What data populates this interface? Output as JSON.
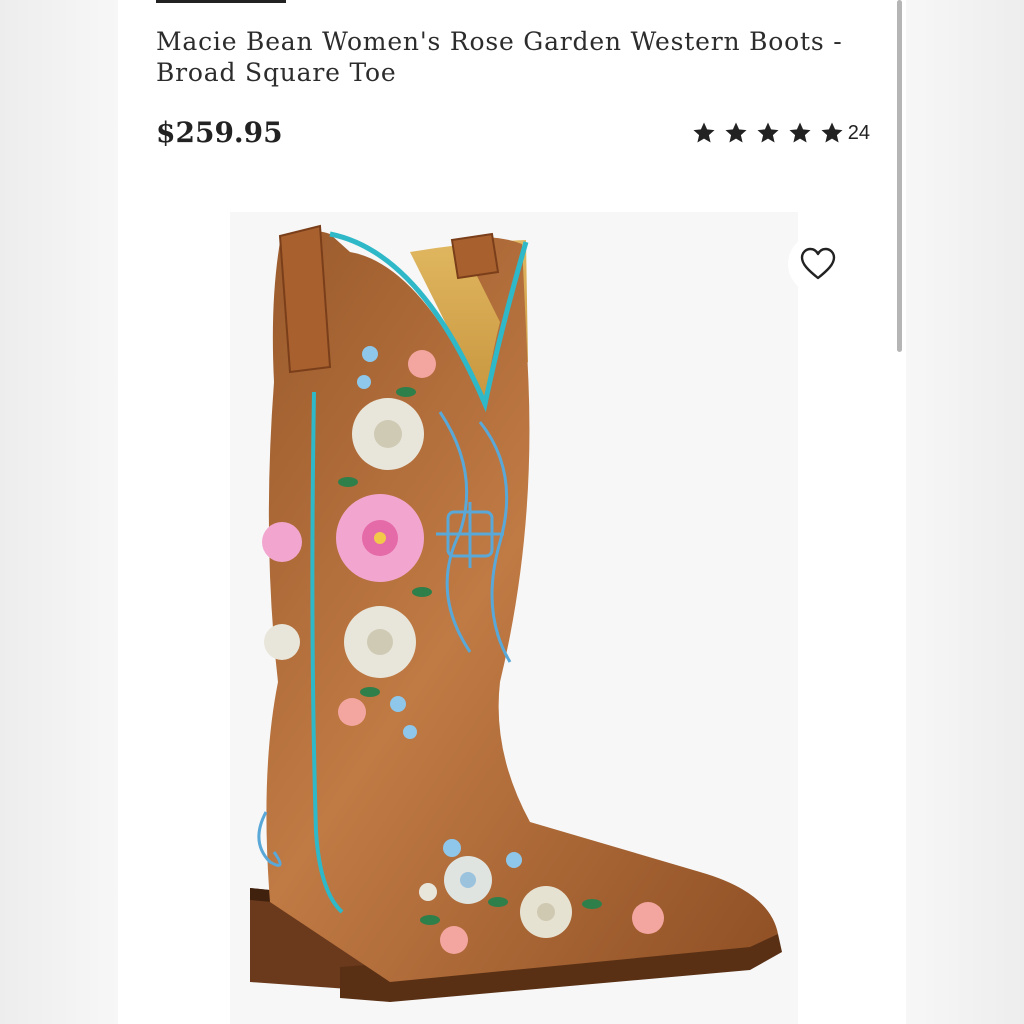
{
  "product": {
    "title": "Macie Bean Women's Rose Garden Western Boots - Broad Square Toe",
    "price": "$259.95",
    "rating": 5,
    "review_count": "24",
    "image_alt": "Macie Bean Women's Rose Garden Western Boots"
  },
  "icons": {
    "star": "star-icon",
    "favorite": "heart-outline-icon"
  },
  "colors": {
    "text": "#2c2c2c",
    "star": "#222222",
    "boot_leather": "#b06a38",
    "piping": "#2fb8c8"
  }
}
